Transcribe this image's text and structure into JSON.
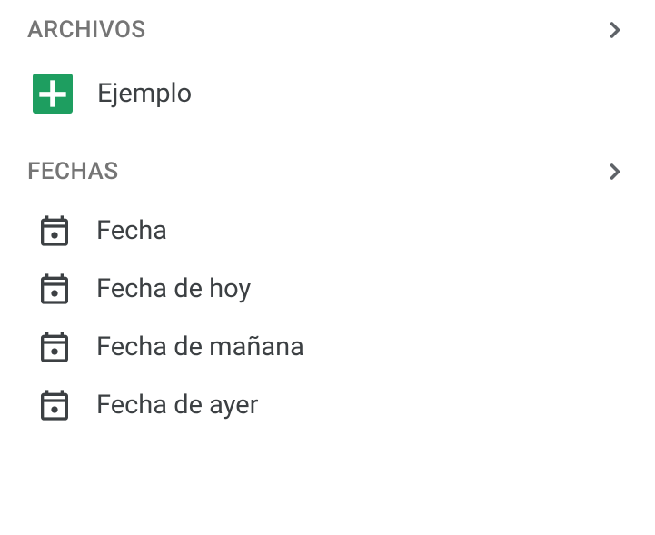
{
  "sections": {
    "files": {
      "title": "ARCHIVOS",
      "items": [
        {
          "label": "Ejemplo"
        }
      ]
    },
    "dates": {
      "title": "FECHAS",
      "items": [
        {
          "label": "Fecha"
        },
        {
          "label": "Fecha de hoy"
        },
        {
          "label": "Fecha de mañana"
        },
        {
          "label": "Fecha de ayer"
        }
      ]
    }
  }
}
